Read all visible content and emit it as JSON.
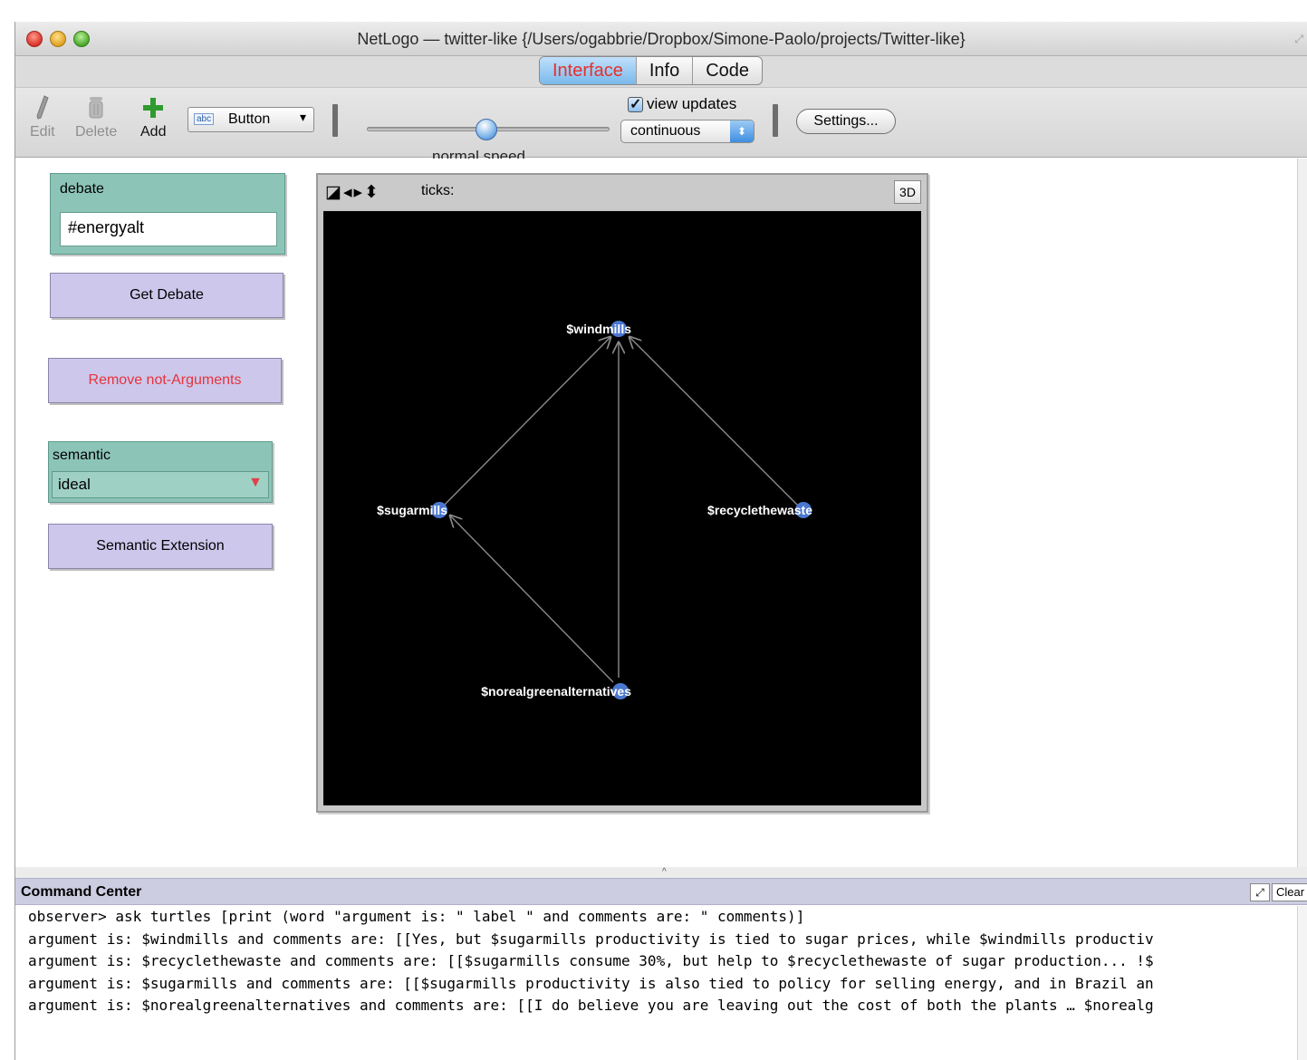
{
  "window": {
    "title": "NetLogo — twitter-like {/Users/ogabbrie/Dropbox/Simone-Paolo/projects/Twitter-like}"
  },
  "tabs": [
    {
      "label": "Interface",
      "active": true
    },
    {
      "label": "Info",
      "active": false
    },
    {
      "label": "Code",
      "active": false
    }
  ],
  "toolbar": {
    "edit_label": "Edit",
    "delete_label": "Delete",
    "add_label": "Add",
    "widget_type": "Button",
    "widget_type_icon": "abc",
    "speed_label": "normal speed",
    "speed_value": 0.5,
    "view_updates_label": "view updates",
    "view_updates_checked": true,
    "update_mode": "continuous",
    "settings_label": "Settings..."
  },
  "widgets": {
    "debate_label": "debate",
    "debate_value": "#energyalt",
    "get_debate_label": "Get Debate",
    "remove_label": "Remove not-Arguments",
    "semantic_label": "semantic",
    "semantic_value": "ideal",
    "semantic_extension_label": "Semantic Extension"
  },
  "view": {
    "ticks_label": "ticks:",
    "three_d_label": "3D",
    "nodes": [
      {
        "label": "$windmills"
      },
      {
        "label": "$sugarmills"
      },
      {
        "label": "$recyclethewaste"
      },
      {
        "label": "$norealgreenalternatives"
      }
    ],
    "colors": {
      "background": "#000000",
      "node": "#4a78d0",
      "link": "#8a8a8a",
      "label": "#ffffff"
    }
  },
  "command_center": {
    "title": "Command Center",
    "clear_label": "Clear",
    "lines": [
      "observer> ask turtles [print (word \"argument is: \" label \" and comments are: \" comments)]",
      "argument is: $windmills and comments are: [[Yes, but $sugarmills productivity is tied to sugar prices, while $windmills productiv",
      "argument is: $recyclethewaste and comments are: [[$sugarmills consume 30%, but help to $recyclethewaste of sugar production... !$",
      "argument is: $sugarmills and comments are: [[$sugarmills productivity is also tied to policy for selling energy, and in Brazil an",
      "argument is: $norealgreenalternatives and comments are: [[I do believe you are leaving out the cost of both the plants … $norealg"
    ]
  }
}
